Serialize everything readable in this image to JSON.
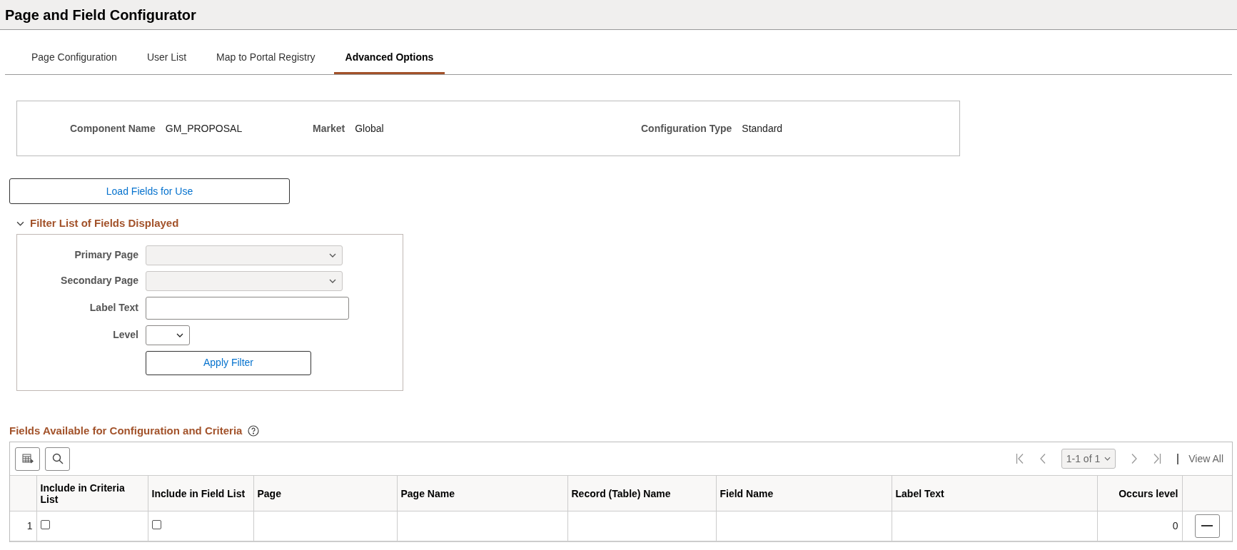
{
  "header": {
    "title": "Page and Field Configurator"
  },
  "tabs": [
    {
      "label": "Page Configuration",
      "selected": false
    },
    {
      "label": "User List",
      "selected": false
    },
    {
      "label": "Map to Portal Registry",
      "selected": false
    },
    {
      "label": "Advanced Options",
      "selected": true
    }
  ],
  "summary": [
    {
      "label": "Component Name",
      "value": "GM_PROPOSAL"
    },
    {
      "label": "Market",
      "value": "Global"
    },
    {
      "label": "Configuration Type",
      "value": "Standard"
    }
  ],
  "load_button": "Load Fields for Use",
  "filter": {
    "title": "Filter List of Fields Displayed",
    "expanded": true,
    "fields": [
      {
        "kind": "select",
        "label": "Primary Page",
        "disabled": true
      },
      {
        "kind": "select",
        "label": "Secondary Page",
        "disabled": true
      },
      {
        "kind": "text",
        "label": "Label Text",
        "disabled": false
      },
      {
        "kind": "small-select",
        "label": "Level",
        "disabled": false
      }
    ],
    "apply_button": "Apply Filter"
  },
  "grid": {
    "title": "Fields Available for Configuration and Criteria",
    "pager": "1-1 of 1",
    "view_all": "View All",
    "columns": [
      "Include in Criteria List",
      "Include in Field List",
      "Page",
      "Page Name",
      "Record (Table) Name",
      "Field Name",
      "Label Text",
      "Occurs level"
    ],
    "rows": [
      {
        "number": "1",
        "criteria": false,
        "field_list": false,
        "page": "",
        "page_name": "",
        "record": "",
        "field_name": "",
        "label_text": "",
        "occurs_level": "0"
      }
    ]
  }
}
